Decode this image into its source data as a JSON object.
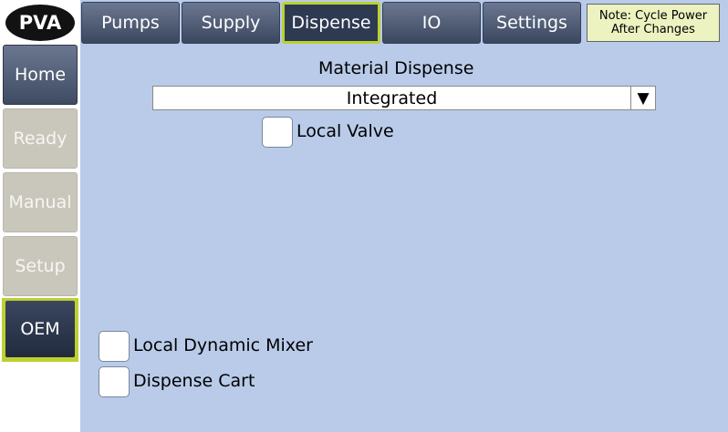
{
  "logo": {
    "text": "PVA"
  },
  "sidebar": {
    "items": [
      {
        "label": "Home",
        "state": "active"
      },
      {
        "label": "Ready",
        "state": "disabled"
      },
      {
        "label": "Manual",
        "state": "disabled"
      },
      {
        "label": "Setup",
        "state": "disabled"
      },
      {
        "label": "OEM",
        "state": "selected"
      }
    ]
  },
  "tabs": [
    {
      "label": "Pumps"
    },
    {
      "label": "Supply"
    },
    {
      "label": "Dispense",
      "selected": true
    },
    {
      "label": "IO"
    },
    {
      "label": "Settings"
    }
  ],
  "note": {
    "line1": "Note: Cycle Power",
    "line2": "After Changes"
  },
  "main": {
    "material_dispense_label": "Material Dispense",
    "dropdown": {
      "value": "Integrated",
      "arrow": "▼"
    },
    "local_valve": {
      "label": "Local Valve",
      "checked": false
    },
    "local_dynamic_mixer": {
      "label": "Local Dynamic Mixer",
      "checked": false
    },
    "dispense_cart": {
      "label": "Dispense Cart",
      "checked": false
    }
  },
  "colors": {
    "background": "#b9cbe9",
    "accent": "#bcd12f",
    "button_dark": "#3b475f",
    "note_bg": "#edf3c0"
  }
}
